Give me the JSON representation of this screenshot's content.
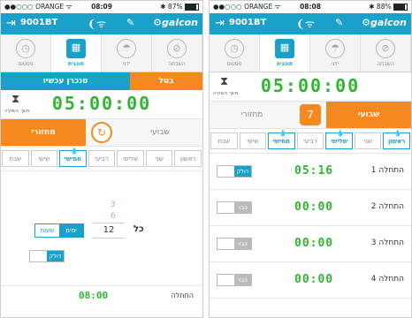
{
  "colors": {
    "accent": "#19a1c9",
    "orange": "#f5891f",
    "digits": "#2fb52f"
  },
  "left": {
    "status": {
      "carrier": "●●○○○ ORANGE ᯤ",
      "time": "08:09",
      "battery": "✱ 87%",
      "battery_level": 0.87
    },
    "appbar": {
      "exit_icon": "⇥",
      "device": "9001BT",
      "wifi_icon": "❨ᯤ",
      "edit_icon": "✎",
      "logo": "⚙galcon"
    },
    "tabs": [
      {
        "icon": "◷",
        "label": "ססטוס",
        "active": false
      },
      {
        "icon": "▦",
        "label": "תוכנית",
        "active": true
      },
      {
        "icon": "☂",
        "label": "ידני",
        "active": false
      },
      {
        "icon": "⊘",
        "label": "השבתה",
        "active": false
      }
    ],
    "sync_label": "סנכרן עכשיו",
    "cancel_label": "בטל",
    "timer": {
      "hourglass": "⧗",
      "sub": "משך השקיה",
      "value": "05:00:00"
    },
    "mode": {
      "cyclic": "מחזורי",
      "weekly": "שבועי",
      "center_icon": "↻"
    },
    "days": [
      {
        "label": "שבת",
        "on": false,
        "drop": ""
      },
      {
        "label": "שישי",
        "on": false,
        "drop": ""
      },
      {
        "label": "חמישי",
        "on": true,
        "drop": "💧"
      },
      {
        "label": "רביעי",
        "on": false,
        "drop": ""
      },
      {
        "label": "שלישי",
        "on": false,
        "drop": ""
      },
      {
        "label": "שני",
        "on": false,
        "drop": ""
      },
      {
        "label": "ראשון",
        "on": false,
        "drop": ""
      }
    ],
    "picker": {
      "above1": "3",
      "above2": "6",
      "value": "12",
      "units": [
        "שעות",
        "ימים"
      ],
      "selected_unit": "ימים",
      "every_label": "כל"
    },
    "toggle_on_label": "דולק",
    "start": {
      "time": "08:00",
      "label": "התחלה"
    }
  },
  "right": {
    "status": {
      "carrier": "●●○○○ ORANGE ᯤ",
      "time": "08:08",
      "battery": "✱ 88%",
      "battery_level": 0.88
    },
    "appbar": {
      "exit_icon": "⇥",
      "device": "9001BT",
      "wifi_icon": "❨ᯤ",
      "edit_icon": "✎",
      "logo": "⚙galcon"
    },
    "tabs": [
      {
        "icon": "◷",
        "label": "ססטוס",
        "active": false
      },
      {
        "icon": "▦",
        "label": "תוכנית",
        "active": true
      },
      {
        "icon": "☂",
        "label": "ידני",
        "active": false
      },
      {
        "icon": "⊘",
        "label": "השבתה",
        "active": false
      }
    ],
    "timer": {
      "hourglass": "⧗",
      "sub": "משך השקיה",
      "value": "05:00:00"
    },
    "mode": {
      "cyclic": "מחזורי",
      "weekly": "שבועי",
      "center_icon": "7"
    },
    "days": [
      {
        "label": "שבת",
        "on": false,
        "drop": ""
      },
      {
        "label": "שישי",
        "on": false,
        "drop": ""
      },
      {
        "label": "חמישי",
        "on": true,
        "drop": "💧"
      },
      {
        "label": "רביעי",
        "on": false,
        "drop": ""
      },
      {
        "label": "שלישי",
        "on": true,
        "drop": "💧"
      },
      {
        "label": "שני",
        "on": false,
        "drop": ""
      },
      {
        "label": "ראשון",
        "on": true,
        "drop": "💧"
      }
    ],
    "starts": [
      {
        "label": "התחלה 1",
        "time": "05:16",
        "toggle": "דולק",
        "on": true
      },
      {
        "label": "התחלה 2",
        "time": "00:00",
        "toggle": "כבוי",
        "on": false
      },
      {
        "label": "התחלה 3",
        "time": "00:00",
        "toggle": "כבוי",
        "on": false
      },
      {
        "label": "התחלה 4",
        "time": "00:00",
        "toggle": "כבוי",
        "on": false
      }
    ]
  }
}
